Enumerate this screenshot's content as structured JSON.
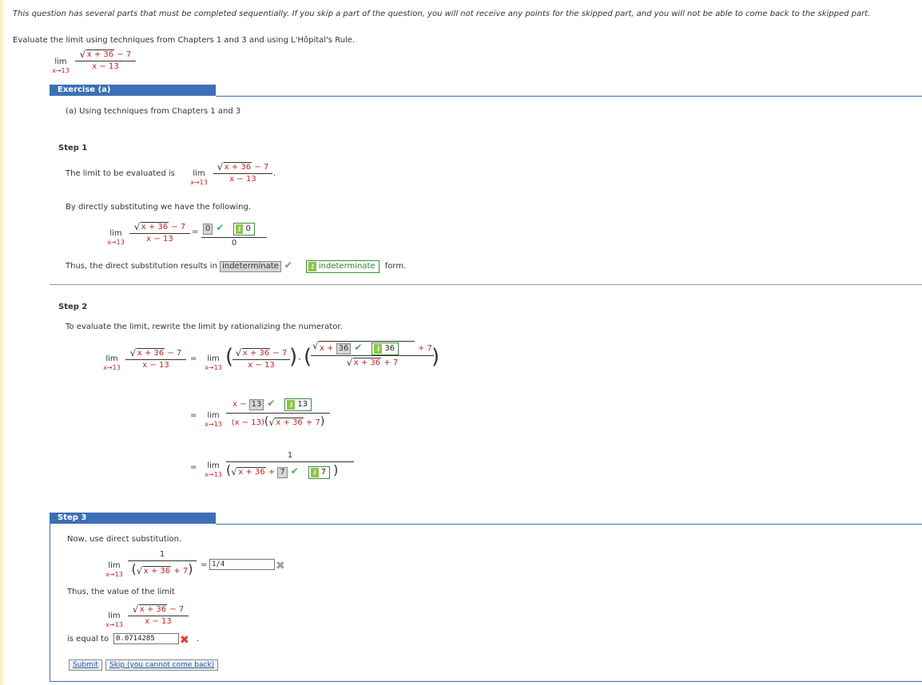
{
  "intro": "This question has several parts that must be completed sequentially. If you skip a part of the question, you will not receive any points for the skipped part, and you will not be able to come back to the skipped part.",
  "task": "Evaluate the limit using techniques from Chapters 1 and 3 and using L'Hôpital's Rule.",
  "limit": {
    "lim": "lim",
    "approach": "x→13",
    "numerator_radicand": "x + 36",
    "numerator_rest": " − 7",
    "denominator": "x − 13"
  },
  "exercise": {
    "header": "Exercise (a)",
    "subtitle": "(a) Using techniques from Chapters 1 and 3"
  },
  "step1": {
    "label": "Step 1",
    "text": "The limit to be evaluated is",
    "period": ".",
    "substitution_text": "By directly substituting we have the following.",
    "equals": "=",
    "num_answer": "0",
    "num_key": "0",
    "den_value": "0",
    "result_prefix": "Thus, the direct substitution results in",
    "result_answer": "indeterminate",
    "result_key": "indeterminate",
    "result_suffix": "form."
  },
  "step2": {
    "label": "Step 2",
    "text": "To evaluate the limit, rewrite the limit by rationalizing the numerator.",
    "equals": "=",
    "dot": "·",
    "conj_radicand_prefix": "x + ",
    "conj_answer": "36",
    "conj_key": "36",
    "conj_suffix": "+ 7",
    "conj_den_rest": " + 7",
    "line2_num_prefix": "x − ",
    "line2_answer": "13",
    "line2_key": "13",
    "line2_den_prefix": "(x − 13)",
    "line2_den_rest": " + 7",
    "line3_num": "1",
    "line3_plus": " + ",
    "line3_answer": "7",
    "line3_key": "7"
  },
  "step3": {
    "label": "Step 3",
    "text": "Now, use direct substitution.",
    "num": "1",
    "den_rest": " + 7",
    "equals": "=",
    "input_value": "1/4",
    "thus_text": "Thus, the value of the limit",
    "is_equal_to": "is equal to",
    "final_value": "0.0714285",
    "final_period": ".",
    "submit": "Submit",
    "skip": "Skip (you cannot come back)"
  },
  "icons": {
    "check": "check-icon",
    "key": "key-icon",
    "x": "x-icon"
  },
  "colors": {
    "accent": "#3d6fb6",
    "check": "#4caf50",
    "wrong_red": "#e53935",
    "wrong_gray": "#9e9e9e",
    "variable_red": "#c02626"
  }
}
